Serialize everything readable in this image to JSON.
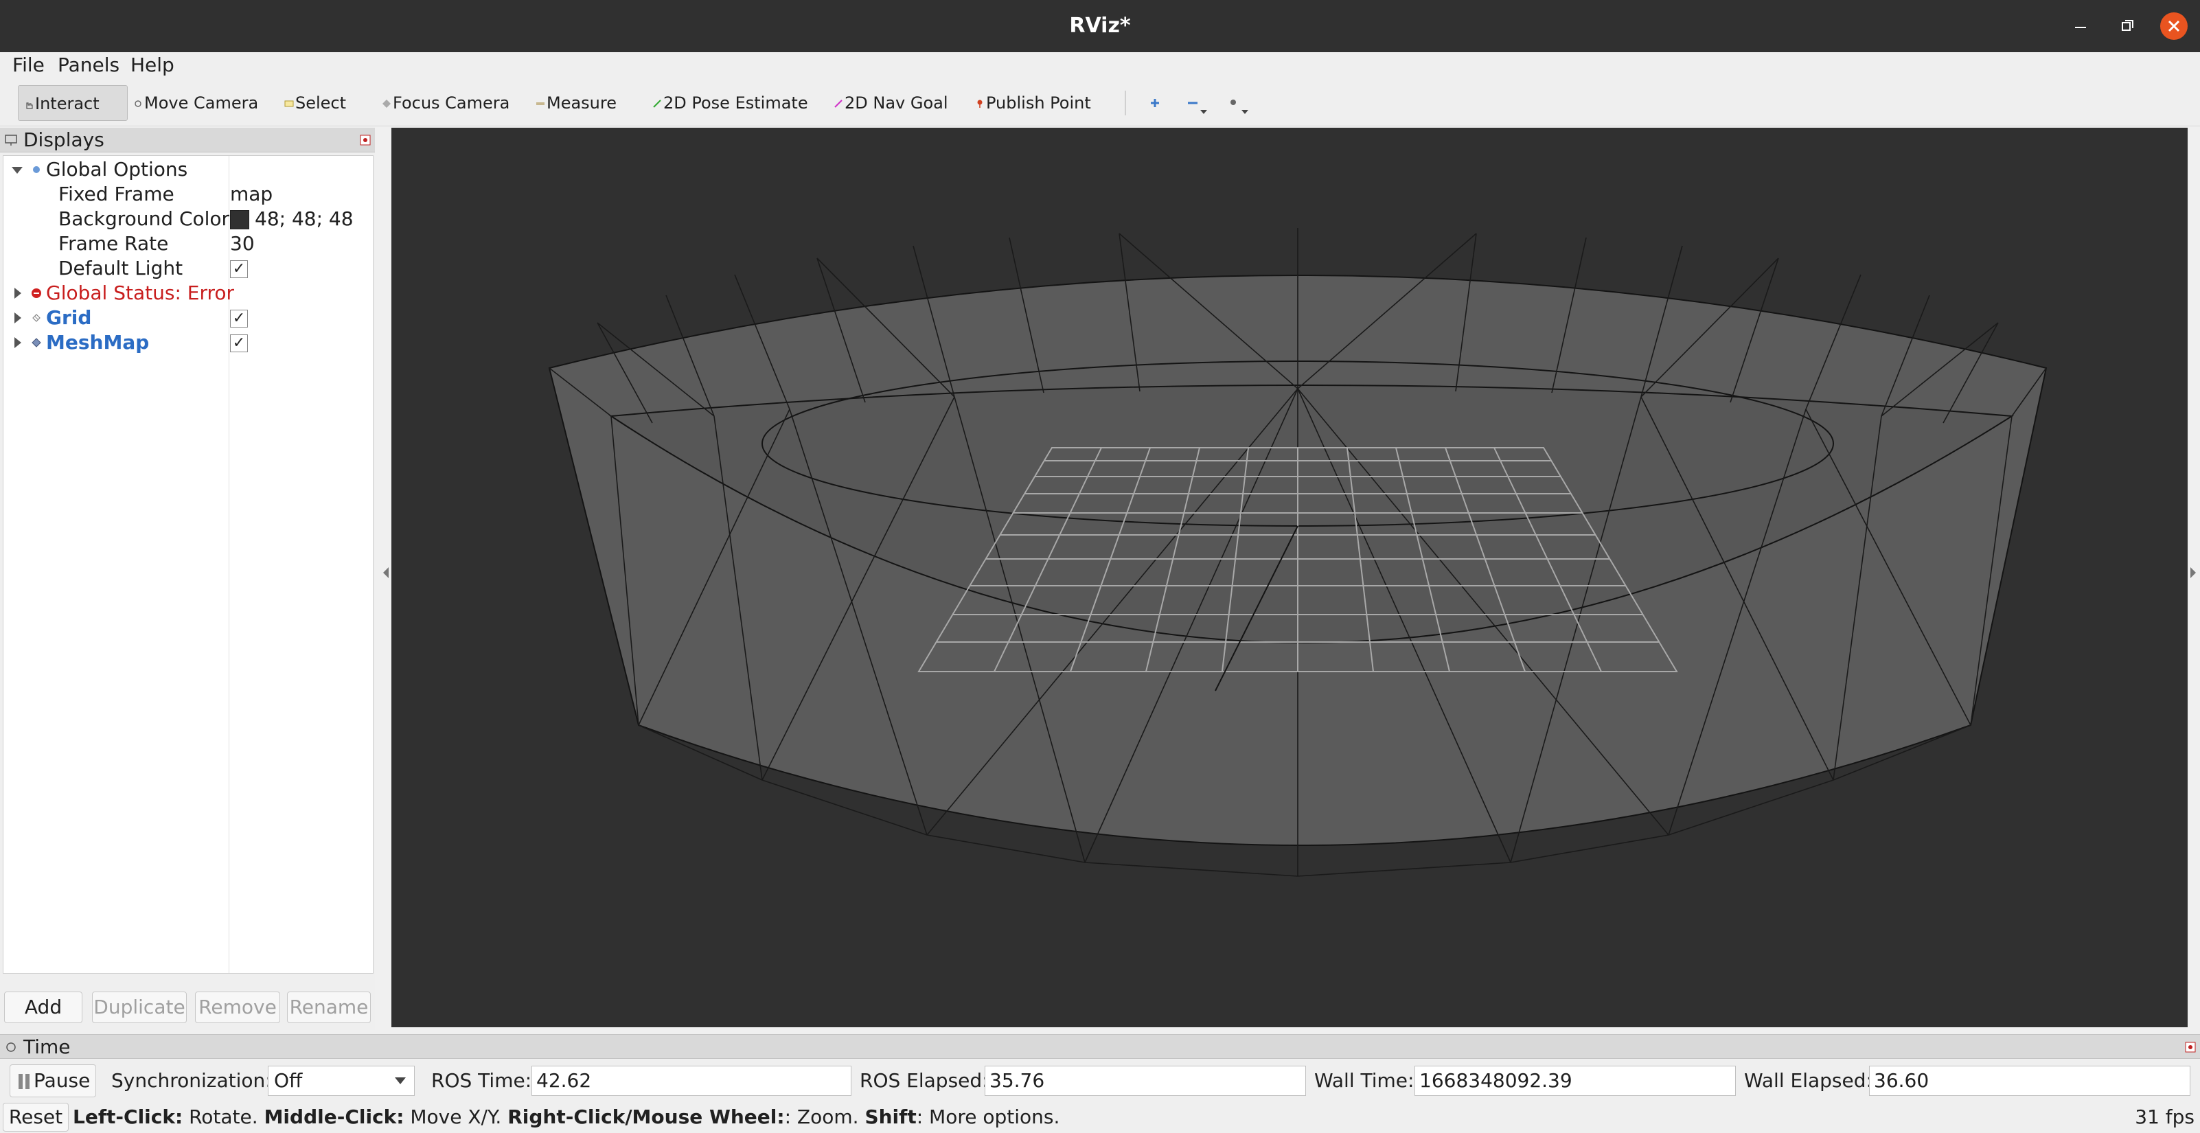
{
  "window": {
    "title": "RViz*"
  },
  "menu": {
    "file": "File",
    "panels": "Panels",
    "help": "Help"
  },
  "toolbar": {
    "interact": "Interact",
    "move_camera": "Move Camera",
    "select": "Select",
    "focus_camera": "Focus Camera",
    "measure": "Measure",
    "pose_estimate": "2D Pose Estimate",
    "nav_goal": "2D Nav Goal",
    "publish_point": "Publish Point"
  },
  "displays": {
    "title": "Displays",
    "global_options": {
      "label": "Global Options",
      "fixed_frame_label": "Fixed Frame",
      "fixed_frame_value": "map",
      "background_color_label": "Background Color",
      "background_color_value": "48; 48; 48",
      "background_color_hex": "#303030",
      "frame_rate_label": "Frame Rate",
      "frame_rate_value": "30",
      "default_light_label": "Default Light",
      "default_light_checked": true
    },
    "global_status": "Global Status: Error",
    "items": [
      {
        "name": "Grid",
        "checked": true
      },
      {
        "name": "MeshMap",
        "checked": true
      }
    ],
    "buttons": {
      "add": "Add",
      "duplicate": "Duplicate",
      "remove": "Remove",
      "rename": "Rename"
    }
  },
  "time": {
    "title": "Time",
    "pause_label": "Pause",
    "sync_label": "Synchronization:",
    "sync_value": "Off",
    "ros_time_label": "ROS Time:",
    "ros_time_value": "42.62",
    "ros_elapsed_label": "ROS Elapsed:",
    "ros_elapsed_value": "35.76",
    "wall_time_label": "Wall Time:",
    "wall_time_value": "1668348092.39",
    "wall_elapsed_label": "Wall Elapsed:",
    "wall_elapsed_value": "36.60"
  },
  "status": {
    "reset_label": "Reset",
    "hint_left": "Left-Click:",
    "hint_left_text": " Rotate. ",
    "hint_middle": "Middle-Click:",
    "hint_middle_text": " Move X/Y. ",
    "hint_right": "Right-Click/Mouse Wheel:",
    "hint_right_text": ": Zoom. ",
    "hint_shift": "Shift",
    "hint_shift_text": ": More options.",
    "fps": "31 fps"
  },
  "colors": {
    "titlebar": "#303030",
    "close_button": "#e95420",
    "viewport_background": "#303030",
    "error_text": "#c81e1e",
    "display_name": "#2b6cc4"
  }
}
